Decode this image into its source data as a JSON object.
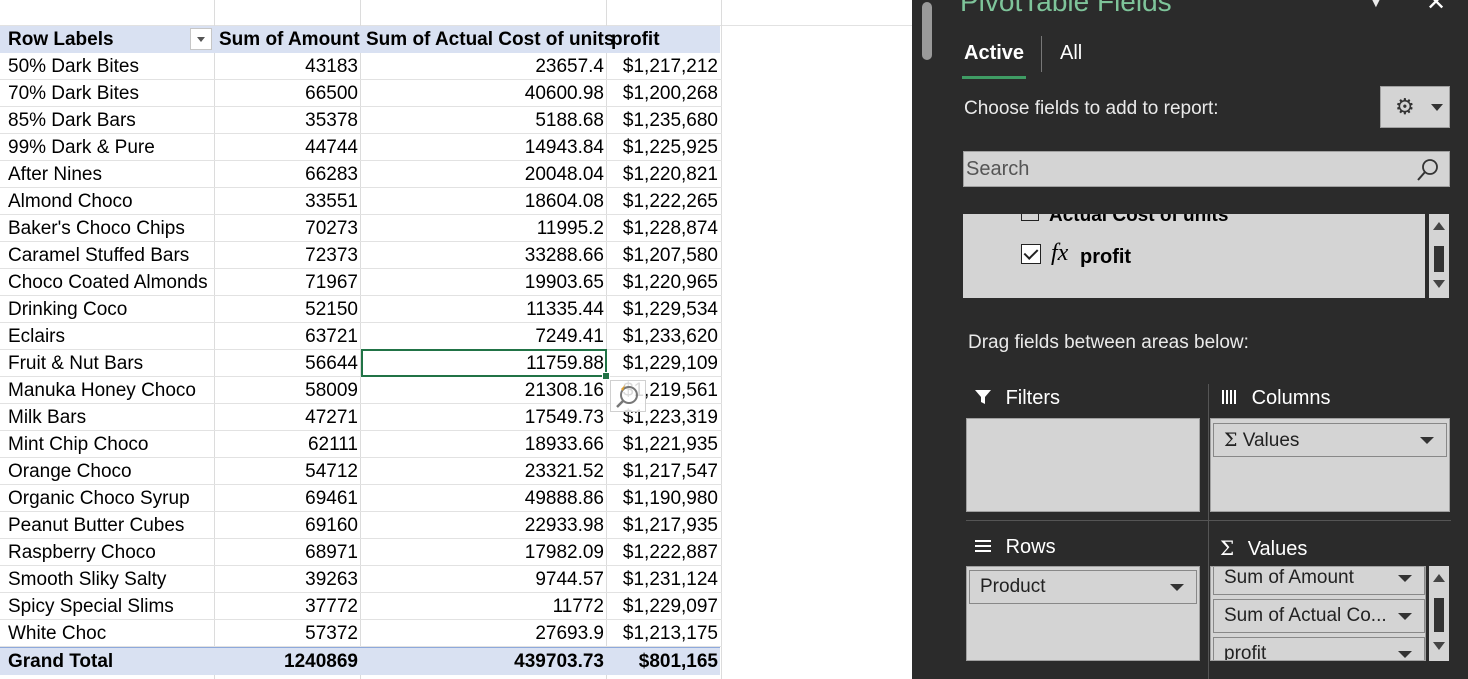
{
  "pivot_table": {
    "headers": {
      "row_labels": "Row Labels",
      "amount": "Sum of Amount",
      "cost": "Sum of Actual Cost of units",
      "profit": "profit"
    },
    "rows": [
      {
        "label": "50% Dark Bites",
        "amount": "43183",
        "cost": "23657.4",
        "profit": "$1,217,212"
      },
      {
        "label": "70% Dark Bites",
        "amount": "66500",
        "cost": "40600.98",
        "profit": "$1,200,268"
      },
      {
        "label": "85% Dark Bars",
        "amount": "35378",
        "cost": "5188.68",
        "profit": "$1,235,680"
      },
      {
        "label": "99% Dark & Pure",
        "amount": "44744",
        "cost": "14943.84",
        "profit": "$1,225,925"
      },
      {
        "label": "After Nines",
        "amount": "66283",
        "cost": "20048.04",
        "profit": "$1,220,821"
      },
      {
        "label": "Almond Choco",
        "amount": "33551",
        "cost": "18604.08",
        "profit": "$1,222,265"
      },
      {
        "label": "Baker's Choco Chips",
        "amount": "70273",
        "cost": "11995.2",
        "profit": "$1,228,874"
      },
      {
        "label": "Caramel Stuffed Bars",
        "amount": "72373",
        "cost": "33288.66",
        "profit": "$1,207,580"
      },
      {
        "label": "Choco Coated Almonds",
        "amount": "71967",
        "cost": "19903.65",
        "profit": "$1,220,965"
      },
      {
        "label": "Drinking Coco",
        "amount": "52150",
        "cost": "11335.44",
        "profit": "$1,229,534"
      },
      {
        "label": "Eclairs",
        "amount": "63721",
        "cost": "7249.41",
        "profit": "$1,233,620"
      },
      {
        "label": "Fruit & Nut Bars",
        "amount": "56644",
        "cost": "11759.88",
        "profit": "$1,229,109"
      },
      {
        "label": "Manuka Honey Choco",
        "amount": "58009",
        "cost": "21308.16",
        "profit": "$1,219,561"
      },
      {
        "label": "Milk Bars",
        "amount": "47271",
        "cost": "17549.73",
        "profit": "$1,223,319"
      },
      {
        "label": "Mint Chip Choco",
        "amount": "62111",
        "cost": "18933.66",
        "profit": "$1,221,935"
      },
      {
        "label": "Orange Choco",
        "amount": "54712",
        "cost": "23321.52",
        "profit": "$1,217,547"
      },
      {
        "label": "Organic Choco Syrup",
        "amount": "69461",
        "cost": "49888.86",
        "profit": "$1,190,980"
      },
      {
        "label": "Peanut Butter Cubes",
        "amount": "69160",
        "cost": "22933.98",
        "profit": "$1,217,935"
      },
      {
        "label": "Raspberry Choco",
        "amount": "68971",
        "cost": "17982.09",
        "profit": "$1,222,887"
      },
      {
        "label": "Smooth Sliky Salty",
        "amount": "39263",
        "cost": "9744.57",
        "profit": "$1,231,124"
      },
      {
        "label": "Spicy Special Slims",
        "amount": "37772",
        "cost": "11772",
        "profit": "$1,229,097"
      },
      {
        "label": "White Choc",
        "amount": "57372",
        "cost": "27693.9",
        "profit": "$1,213,175"
      }
    ],
    "total": {
      "label": "Grand Total",
      "amount": "1240869",
      "cost": "439703.73",
      "profit": "$801,165"
    }
  },
  "pane": {
    "title": "PivotTable Fields",
    "close_glyph": "✕",
    "tabs": {
      "active": "Active",
      "all": "All"
    },
    "choose_label": "Choose fields to add to report:",
    "search_placeholder": "Search",
    "fields": {
      "partial": "Actual Cost of units",
      "profit_fx": "fx",
      "profit": "profit"
    },
    "drag_label": "Drag fields between areas below:",
    "areas": {
      "filters": "Filters",
      "columns": "Columns",
      "rows": "Rows",
      "values": "Values",
      "columns_chip": "Values",
      "rows_chip": "Product",
      "values_chips": [
        "Sum of Amount",
        "Sum of Actual Co...",
        "profit"
      ]
    }
  },
  "colors": {
    "header_fill": "#d9e1f2",
    "selection": "#217346",
    "pane_bg": "#2b2b2b",
    "pane_title": "#7ec49a"
  }
}
